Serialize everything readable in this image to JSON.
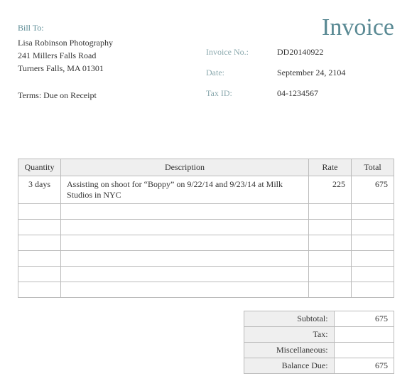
{
  "title": "Invoice",
  "billTo": {
    "label": "Bill To:",
    "name": "Lisa Robinson Photography",
    "street": "241 Millers Falls Road",
    "cityLine": "Turners Falls, MA  01301"
  },
  "terms": "Terms:  Due on Receipt",
  "meta": {
    "invoiceNoLabel": "Invoice No.:",
    "invoiceNo": "DD20140922",
    "dateLabel": "Date:",
    "date": "September 24, 2104",
    "taxIdLabel": "Tax ID:",
    "taxId": "04-1234567"
  },
  "columns": {
    "qty": "Quantity",
    "desc": "Description",
    "rate": "Rate",
    "total": "Total"
  },
  "lines": [
    {
      "qty": "3 days",
      "desc": "Assisting on shoot for “Boppy” on 9/22/14 and 9/23/14 at Milk Studios in NYC",
      "rate": "225",
      "total": "675"
    },
    {
      "qty": "",
      "desc": "",
      "rate": "",
      "total": ""
    },
    {
      "qty": "",
      "desc": "",
      "rate": "",
      "total": ""
    },
    {
      "qty": "",
      "desc": "",
      "rate": "",
      "total": ""
    },
    {
      "qty": "",
      "desc": "",
      "rate": "",
      "total": ""
    },
    {
      "qty": "",
      "desc": "",
      "rate": "",
      "total": ""
    },
    {
      "qty": "",
      "desc": "",
      "rate": "",
      "total": ""
    }
  ],
  "totals": {
    "subtotalLabel": "Subtotal:",
    "subtotal": "675",
    "taxLabel": "Tax:",
    "tax": "",
    "miscLabel": "Miscellaneous:",
    "misc": "",
    "balanceLabel": "Balance Due:",
    "balance": "675"
  }
}
